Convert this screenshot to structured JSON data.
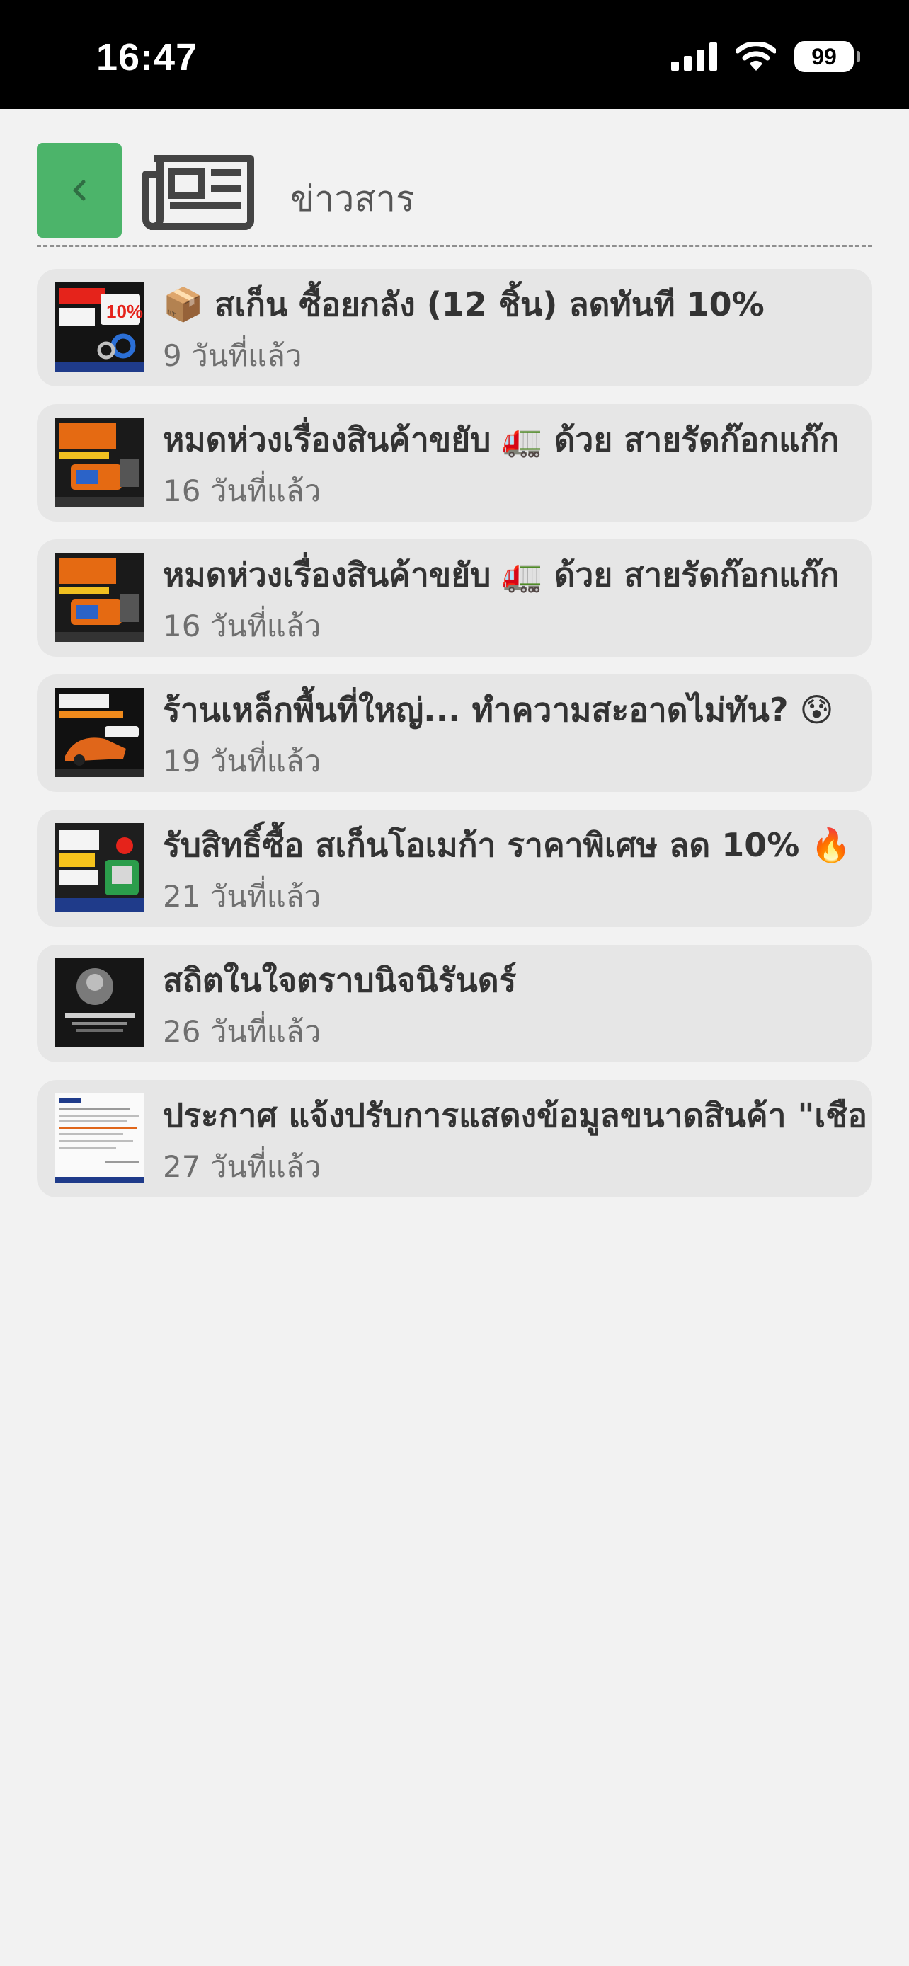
{
  "status_bar": {
    "time": "16:47",
    "battery": "99"
  },
  "header": {
    "back_icon": "chevron-left-icon",
    "title_icon": "newspaper-icon",
    "title": "ข่าวสาร",
    "accent_color": "#4cb46a"
  },
  "news": [
    {
      "title": "📦 สเก็น ซื้อยกลัง (12 ชิ้น) ลดทันที 10%",
      "time": "9 วันที่แล้ว"
    },
    {
      "title": "หมดห่วงเรื่องสินค้าขยับ 🚛 ด้วย สายรัดก๊อกแก๊ก",
      "time": "16 วันที่แล้ว"
    },
    {
      "title": "หมดห่วงเรื่องสินค้าขยับ 🚛 ด้วย สายรัดก๊อกแก๊ก",
      "time": "16 วันที่แล้ว"
    },
    {
      "title": "ร้านเหล็กพื้นที่ใหญ่... ทำความสะอาดไม่ทัน? 😰",
      "time": "19 วันที่แล้ว"
    },
    {
      "title": "รับสิทธิ์ซื้อ สเก็นโอเมก้า ราคาพิเศษ ลด 10% 🔥",
      "time": "21 วันที่แล้ว"
    },
    {
      "title": "สถิตในใจตราบนิจนิรันดร์",
      "time": "26 วันที่แล้ว"
    },
    {
      "title": "ประกาศ แจ้งปรับการแสดงข้อมูลขนาดสินค้า \"เชือ",
      "time": "27 วันที่แล้ว"
    }
  ]
}
